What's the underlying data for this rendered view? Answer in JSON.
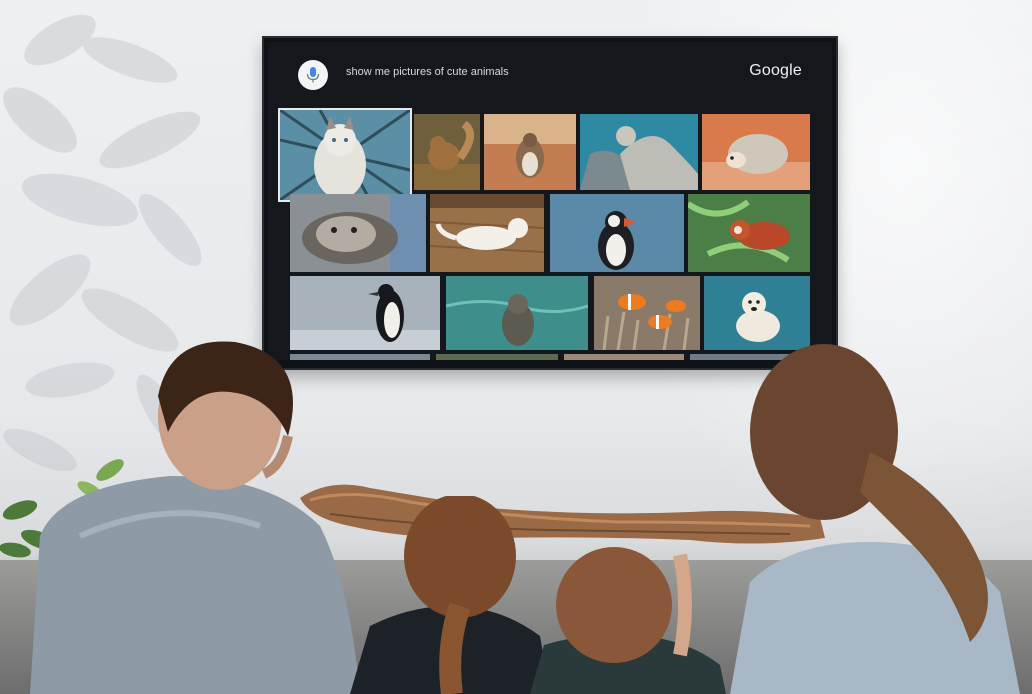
{
  "tv": {
    "query_text": "show me pictures of cute animals",
    "brand": "Google",
    "icons": {
      "mic": "mic-icon"
    }
  },
  "photos": [
    {
      "name": "cat"
    },
    {
      "name": "squirrel"
    },
    {
      "name": "bird"
    },
    {
      "name": "seal"
    },
    {
      "name": "hedgehog"
    },
    {
      "name": "otter"
    },
    {
      "name": "white-cat"
    },
    {
      "name": "puffin"
    },
    {
      "name": "red-panda"
    },
    {
      "name": "penguin"
    },
    {
      "name": "sea-lion"
    },
    {
      "name": "clownfish"
    },
    {
      "name": "polar-bear"
    }
  ],
  "colors": {
    "wall": "#eef0f2",
    "tv_frame": "#0f1216",
    "screen_bg": "#14171b"
  }
}
